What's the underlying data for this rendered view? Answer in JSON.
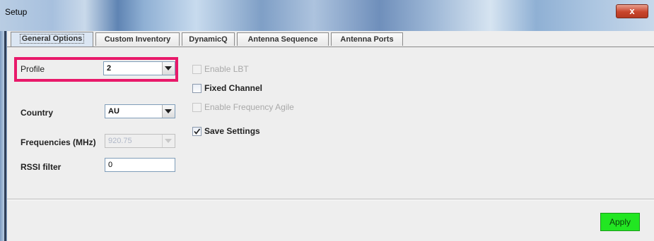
{
  "window": {
    "title": "Setup",
    "close_label": "x"
  },
  "tabs": [
    {
      "label": "General Options"
    },
    {
      "label": "Custom Inventory"
    },
    {
      "label": "DynamicQ"
    },
    {
      "label": "Antenna Sequence"
    },
    {
      "label": "Antenna Ports"
    }
  ],
  "form": {
    "profile": {
      "label": "Profile",
      "value": "2"
    },
    "country": {
      "label": "Country",
      "value": "AU"
    },
    "frequencies": {
      "label": "Frequencies (MHz)",
      "value": "920.75"
    },
    "rssi": {
      "label": "RSSI filter",
      "value": "0"
    }
  },
  "options": {
    "enable_lbt": {
      "label": "Enable LBT",
      "checked": false,
      "enabled": false
    },
    "fixed_channel": {
      "label": "Fixed Channel",
      "checked": false,
      "enabled": true
    },
    "enable_freq_agile": {
      "label": "Enable Frequency Agile",
      "checked": false,
      "enabled": false
    },
    "save_settings": {
      "label": "Save Settings",
      "checked": true,
      "enabled": true
    }
  },
  "apply_label": "Apply",
  "colors": {
    "highlight": "#e8196a",
    "apply": "#22e622"
  }
}
